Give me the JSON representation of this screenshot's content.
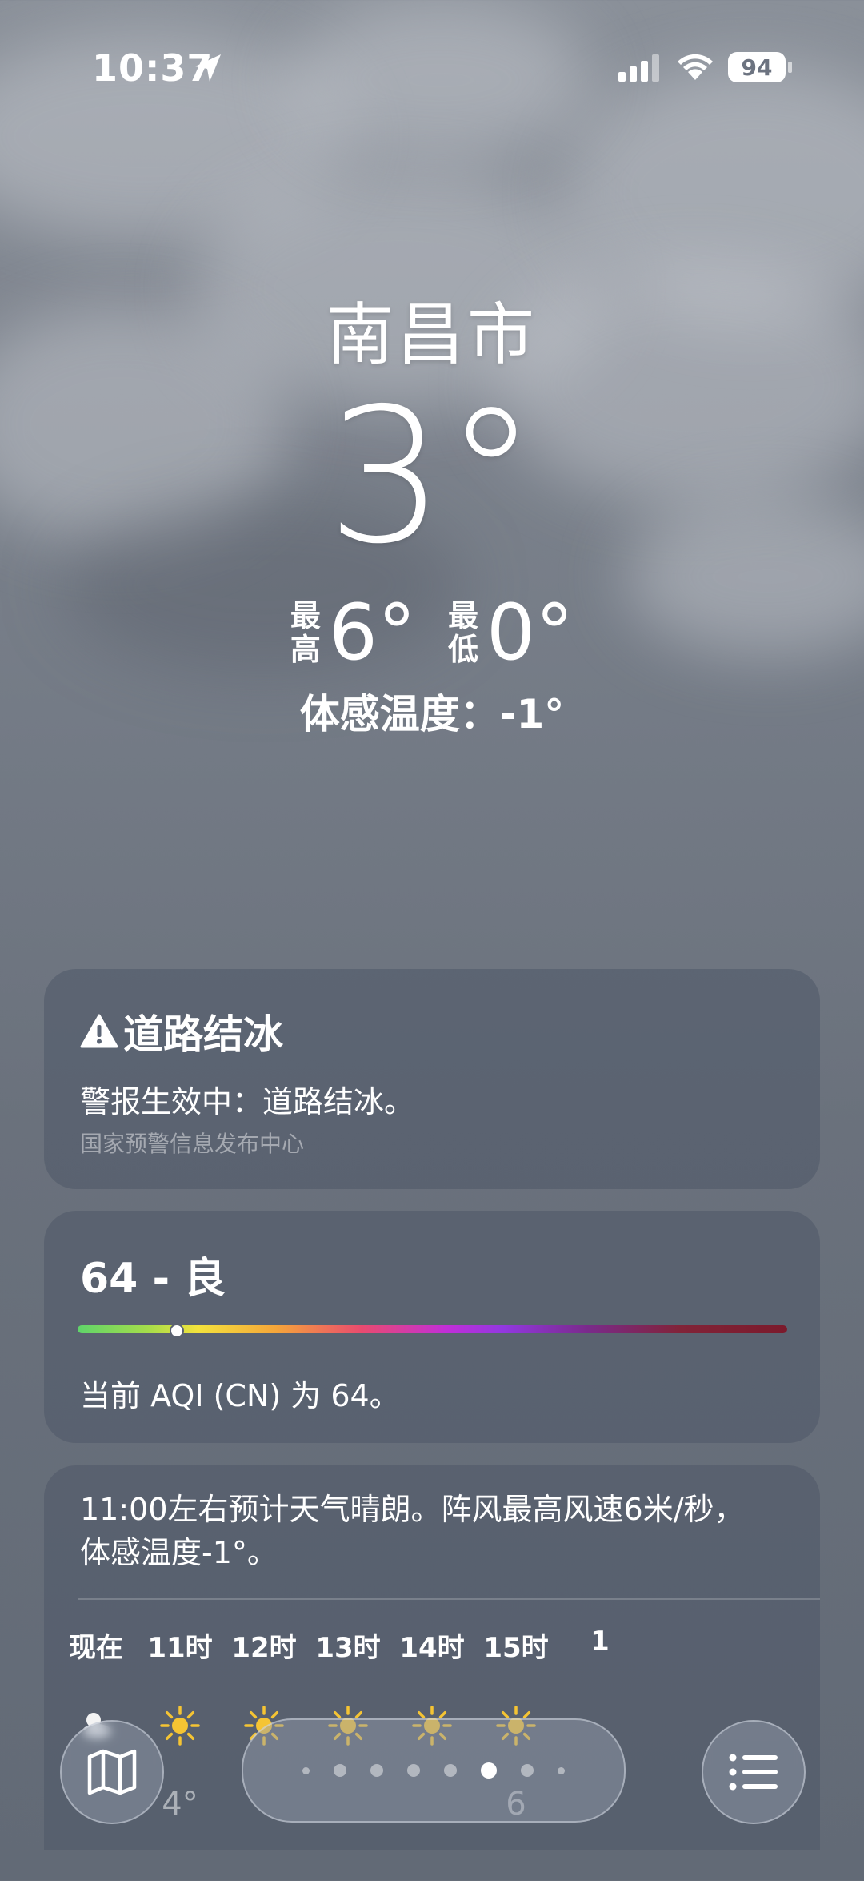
{
  "status_bar": {
    "time": "10:37",
    "battery": "94"
  },
  "weather": {
    "city": "南昌市",
    "temperature": "3°",
    "high_label_1": "最",
    "high_label_2": "高",
    "high": "6°",
    "low_label_1": "最",
    "low_label_2": "低",
    "low": "0°",
    "feels_like": "体感温度：-1°"
  },
  "alert": {
    "title": "道路结冰",
    "text": "警报生效中：道路结冰。",
    "source": "国家预警信息发布中心"
  },
  "aqi": {
    "title": "64 - 良",
    "level": 0.14,
    "text": "当前 AQI (CN) 为 64。"
  },
  "forecast": {
    "summary_line1": "11:00左右预计天气晴朗。阵风最高风速6米/秒，",
    "summary_line2": "体感温度-1°。",
    "hours": [
      "现在",
      "11时",
      "12时",
      "13时",
      "14时",
      "15时",
      "1"
    ],
    "temps": [
      "",
      "4°",
      "",
      "",
      "",
      "6"
    ],
    "icons": [
      "moon-cloud-icon",
      "sun-icon",
      "sun-icon",
      "sun-icon",
      "sun-icon",
      "sun-icon"
    ]
  },
  "nav": {
    "page_count": 8,
    "active_page": 5
  },
  "colors": {
    "sun": "#f5c433",
    "accent": "#ffffff"
  }
}
